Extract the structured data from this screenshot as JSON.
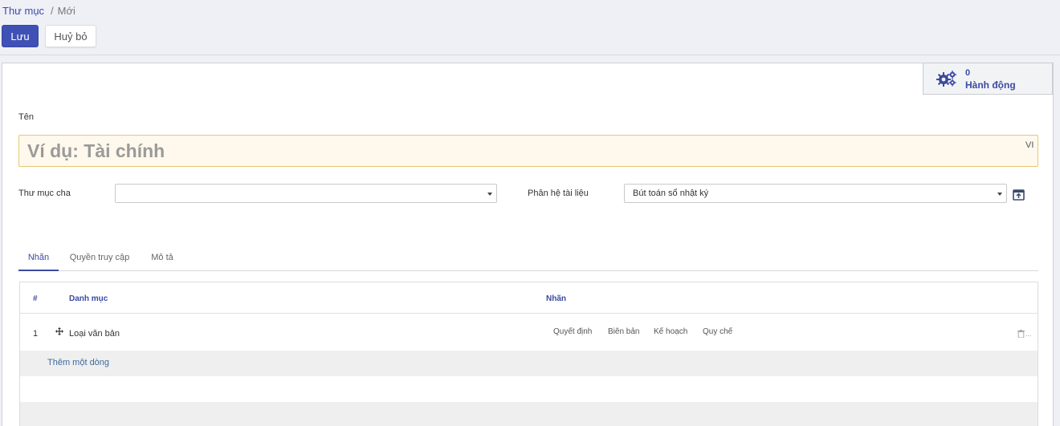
{
  "breadcrumb": {
    "parent": "Thư mục",
    "separator": "/",
    "current": "Mới"
  },
  "toolbar": {
    "save_label": "Lưu",
    "cancel_label": "Huỷ bỏ"
  },
  "action_box": {
    "count": "0",
    "label": "Hành động",
    "icon": "gears-icon"
  },
  "form": {
    "name_label": "Tên",
    "name_placeholder": "Ví dụ: Tài chính",
    "lang": "VI",
    "parent_label": "Thư mục cha",
    "parent_value": "",
    "module_label": "Phân hệ tài liệu",
    "module_value": "Bút toán sổ nhật ký"
  },
  "tabs": [
    {
      "label": "Nhãn",
      "active": true
    },
    {
      "label": "Quyền truy cập",
      "active": false
    },
    {
      "label": "Mô tả",
      "active": false
    }
  ],
  "table": {
    "headers": {
      "index": "#",
      "category": "Danh mục",
      "tags": "Nhãn"
    },
    "rows": [
      {
        "index": "1",
        "category": "Loại văn bản",
        "tags": [
          "Quyết định",
          "Biên bản",
          "Kế hoạch",
          "Quy chế"
        ]
      }
    ],
    "add_line": "Thêm một dòng",
    "trash_suffix": "..."
  },
  "colors": {
    "primary": "#3f51b5",
    "link": "#3c4ba0",
    "required_bg": "#fff8ec",
    "required_border": "#e8c874"
  }
}
